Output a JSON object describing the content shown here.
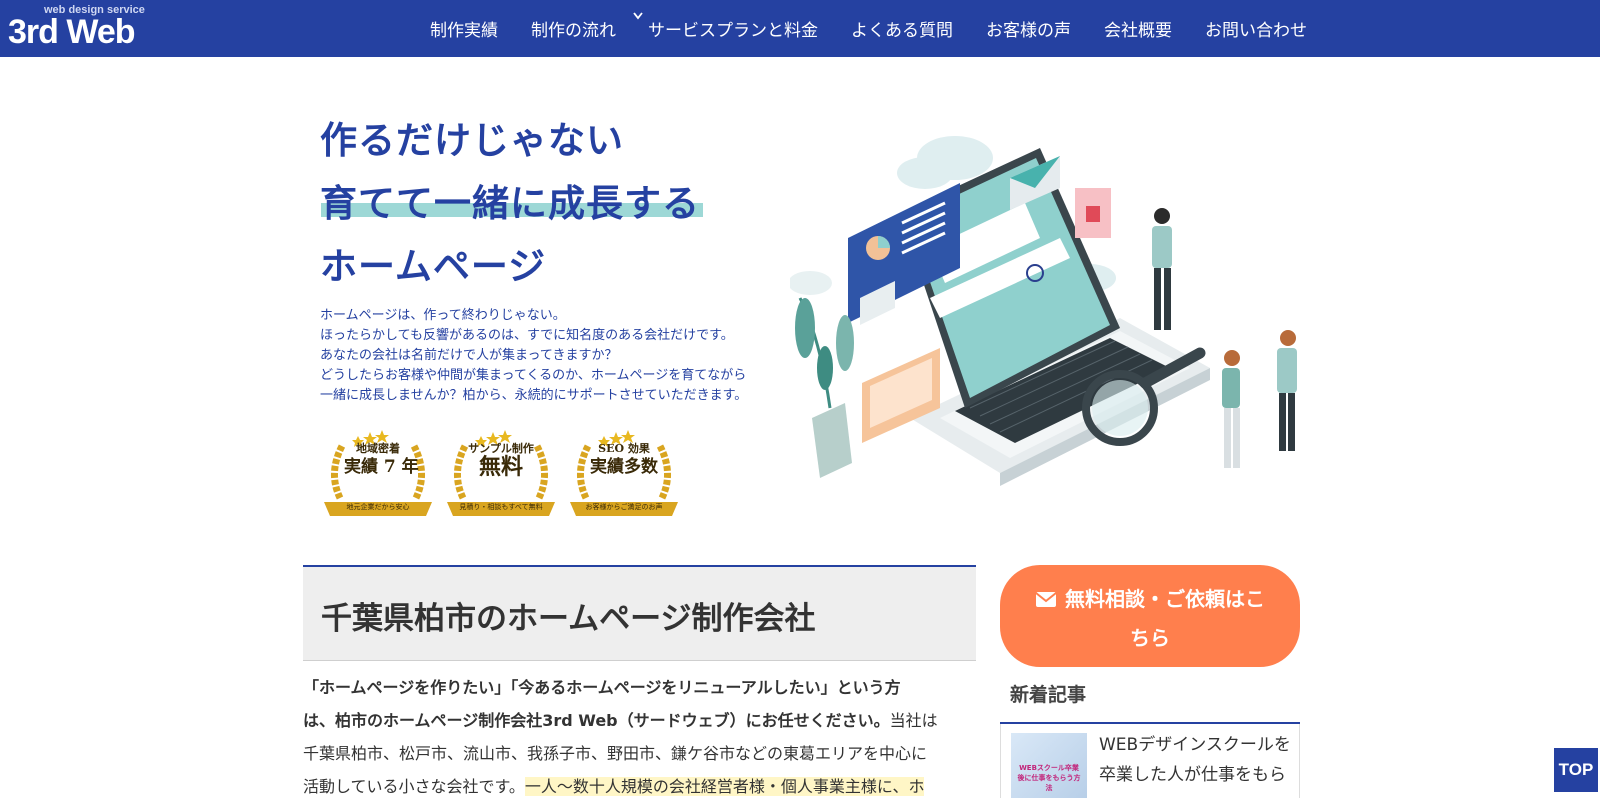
{
  "brand": {
    "tagline": "web design service",
    "name": "3rd Web"
  },
  "nav": {
    "items": [
      {
        "label": "制作実績"
      },
      {
        "label": "制作の流れ"
      },
      {
        "label": "サービスプランと料金"
      },
      {
        "label": "よくある質問"
      },
      {
        "label": "お客様の声"
      },
      {
        "label": "会社概要"
      },
      {
        "label": "お問い合わせ"
      }
    ]
  },
  "hero": {
    "headline_1": "作るだけじゃない",
    "headline_2": "育てて一緒に成長する",
    "headline_3": "ホームページ",
    "paragraph": [
      "ホームページは、作って終わりじゃない。",
      "ほったらかしても反響があるのは、すでに知名度のある会社だけです。",
      "あなたの会社は名前だけで人が集まってきますか？",
      "どうしたらお客様や仲間が集まってくるのか、ホームページを育てながら",
      "一緒に成長しませんか？柏から、永続的にサポートさせていただきます。"
    ],
    "badges": [
      {
        "line1": "地域密着",
        "line2": "実績 7 年",
        "ribbon": "地元企業だから安心"
      },
      {
        "line1": "サンプル制作",
        "line2": "無料",
        "ribbon": "見積り・相談もすべて無料"
      },
      {
        "line1": "SEO 効果",
        "line2": "実績多数",
        "ribbon": "お客様からご満足のお声"
      }
    ]
  },
  "main": {
    "section_title": "千葉県柏市のホームページ制作会社",
    "intro_bold_1": "「ホームページを作りたい」「今あるホームページをリニューアルしたい」という方",
    "intro_bold_2": "は、柏市のホームページ制作会社3rd Web（サードウェブ）にお任せください。",
    "intro_2_tail": "当社は",
    "intro_3": "千葉県柏市、松戸市、流山市、我孫子市、野田市、鎌ケ谷市などの東葛エリアを中心に",
    "intro_4_start": "活動している小さな会社です。",
    "intro_4_mark": "一人～数十人規模の会社経営者様・個人事業主様に、ホ"
  },
  "sidebar": {
    "cta_line1": "無料相談・ご依頼はこ",
    "cta_line2": "ちら",
    "recent_heading": "新着記事",
    "article": {
      "thumb_text": "WEBスクール卒業後に仕事をもらう方法",
      "title_line1": "WEBデザインスクールを",
      "title_line2": "卒業した人が仕事をもら"
    }
  },
  "top_button": "TOP",
  "colors": {
    "primary": "#2541a1",
    "accent": "#ff7f4d",
    "teal": "#9dd8d6",
    "gold": "#d9a520"
  }
}
